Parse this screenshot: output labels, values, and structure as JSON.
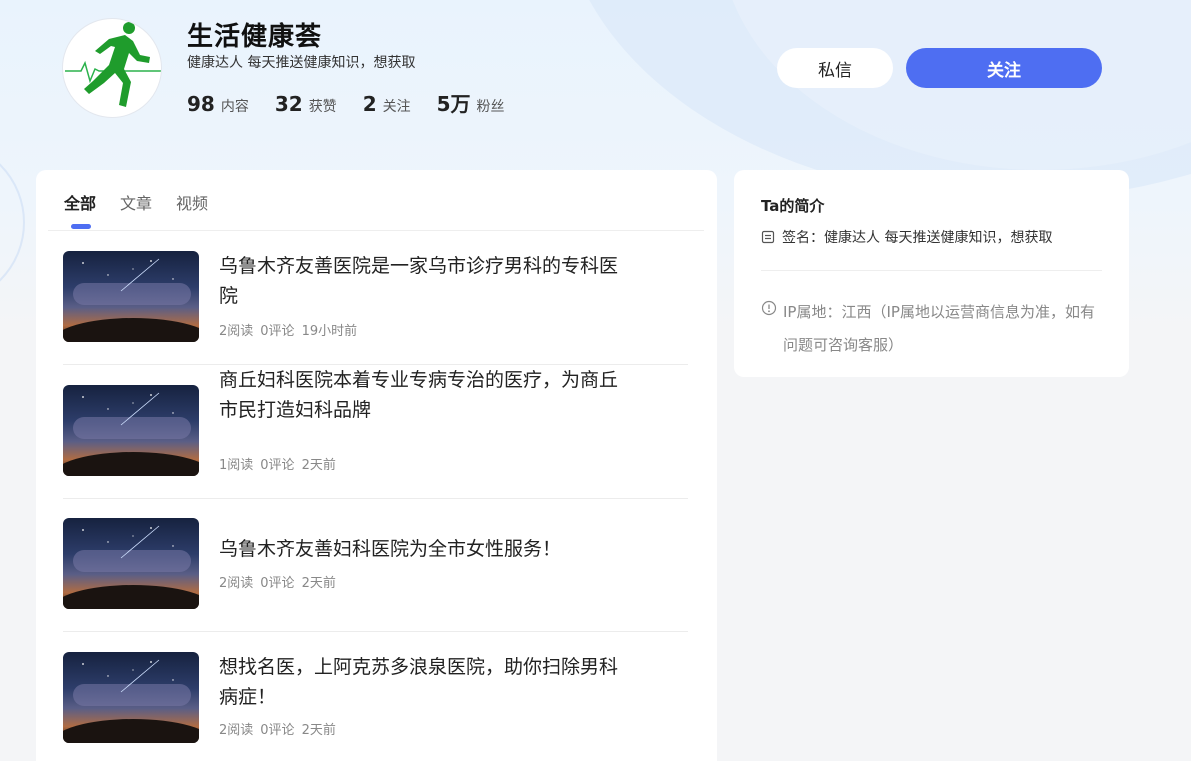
{
  "profile": {
    "name": "生活健康荟",
    "bio": "健康达人 每天推送健康知识，想获取",
    "avatar_icon": "runner-heartbeat-icon",
    "stats": [
      {
        "num": "98",
        "label": "内容"
      },
      {
        "num": "32",
        "label": "获赞"
      },
      {
        "num": "2",
        "label": "关注"
      },
      {
        "num": "5万",
        "label": "粉丝"
      }
    ]
  },
  "actions": {
    "message_label": "私信",
    "follow_label": "关注"
  },
  "colors": {
    "accent": "#4e6ef2",
    "avatar_green": "#1f9c2c"
  },
  "tabs": [
    {
      "label": "全部",
      "active": true
    },
    {
      "label": "文章",
      "active": false
    },
    {
      "label": "视频",
      "active": false
    }
  ],
  "articles": [
    {
      "title": "乌鲁木齐友善医院是一家乌市诊疗男科的专科医院",
      "reads": "2阅读",
      "comments": "0评论",
      "time": "19小时前"
    },
    {
      "title": "商丘妇科医院本着专业专病专治的医疗，为商丘市民打造妇科品牌",
      "reads": "1阅读",
      "comments": "0评论",
      "time": "2天前"
    },
    {
      "title": "乌鲁木齐友善妇科医院为全市女性服务！",
      "reads": "2阅读",
      "comments": "0评论",
      "time": "2天前"
    },
    {
      "title": "想找名医，上阿克苏多浪泉医院，助你扫除男科病症！",
      "reads": "2阅读",
      "comments": "0评论",
      "time": "2天前"
    }
  ],
  "intro": {
    "title": "Ta的简介",
    "signature": "签名：健康达人 每天推送健康知识，想获取",
    "ip": "IP属地：江西（IP属地以运营商信息为准，如有问题可咨询客服）"
  }
}
